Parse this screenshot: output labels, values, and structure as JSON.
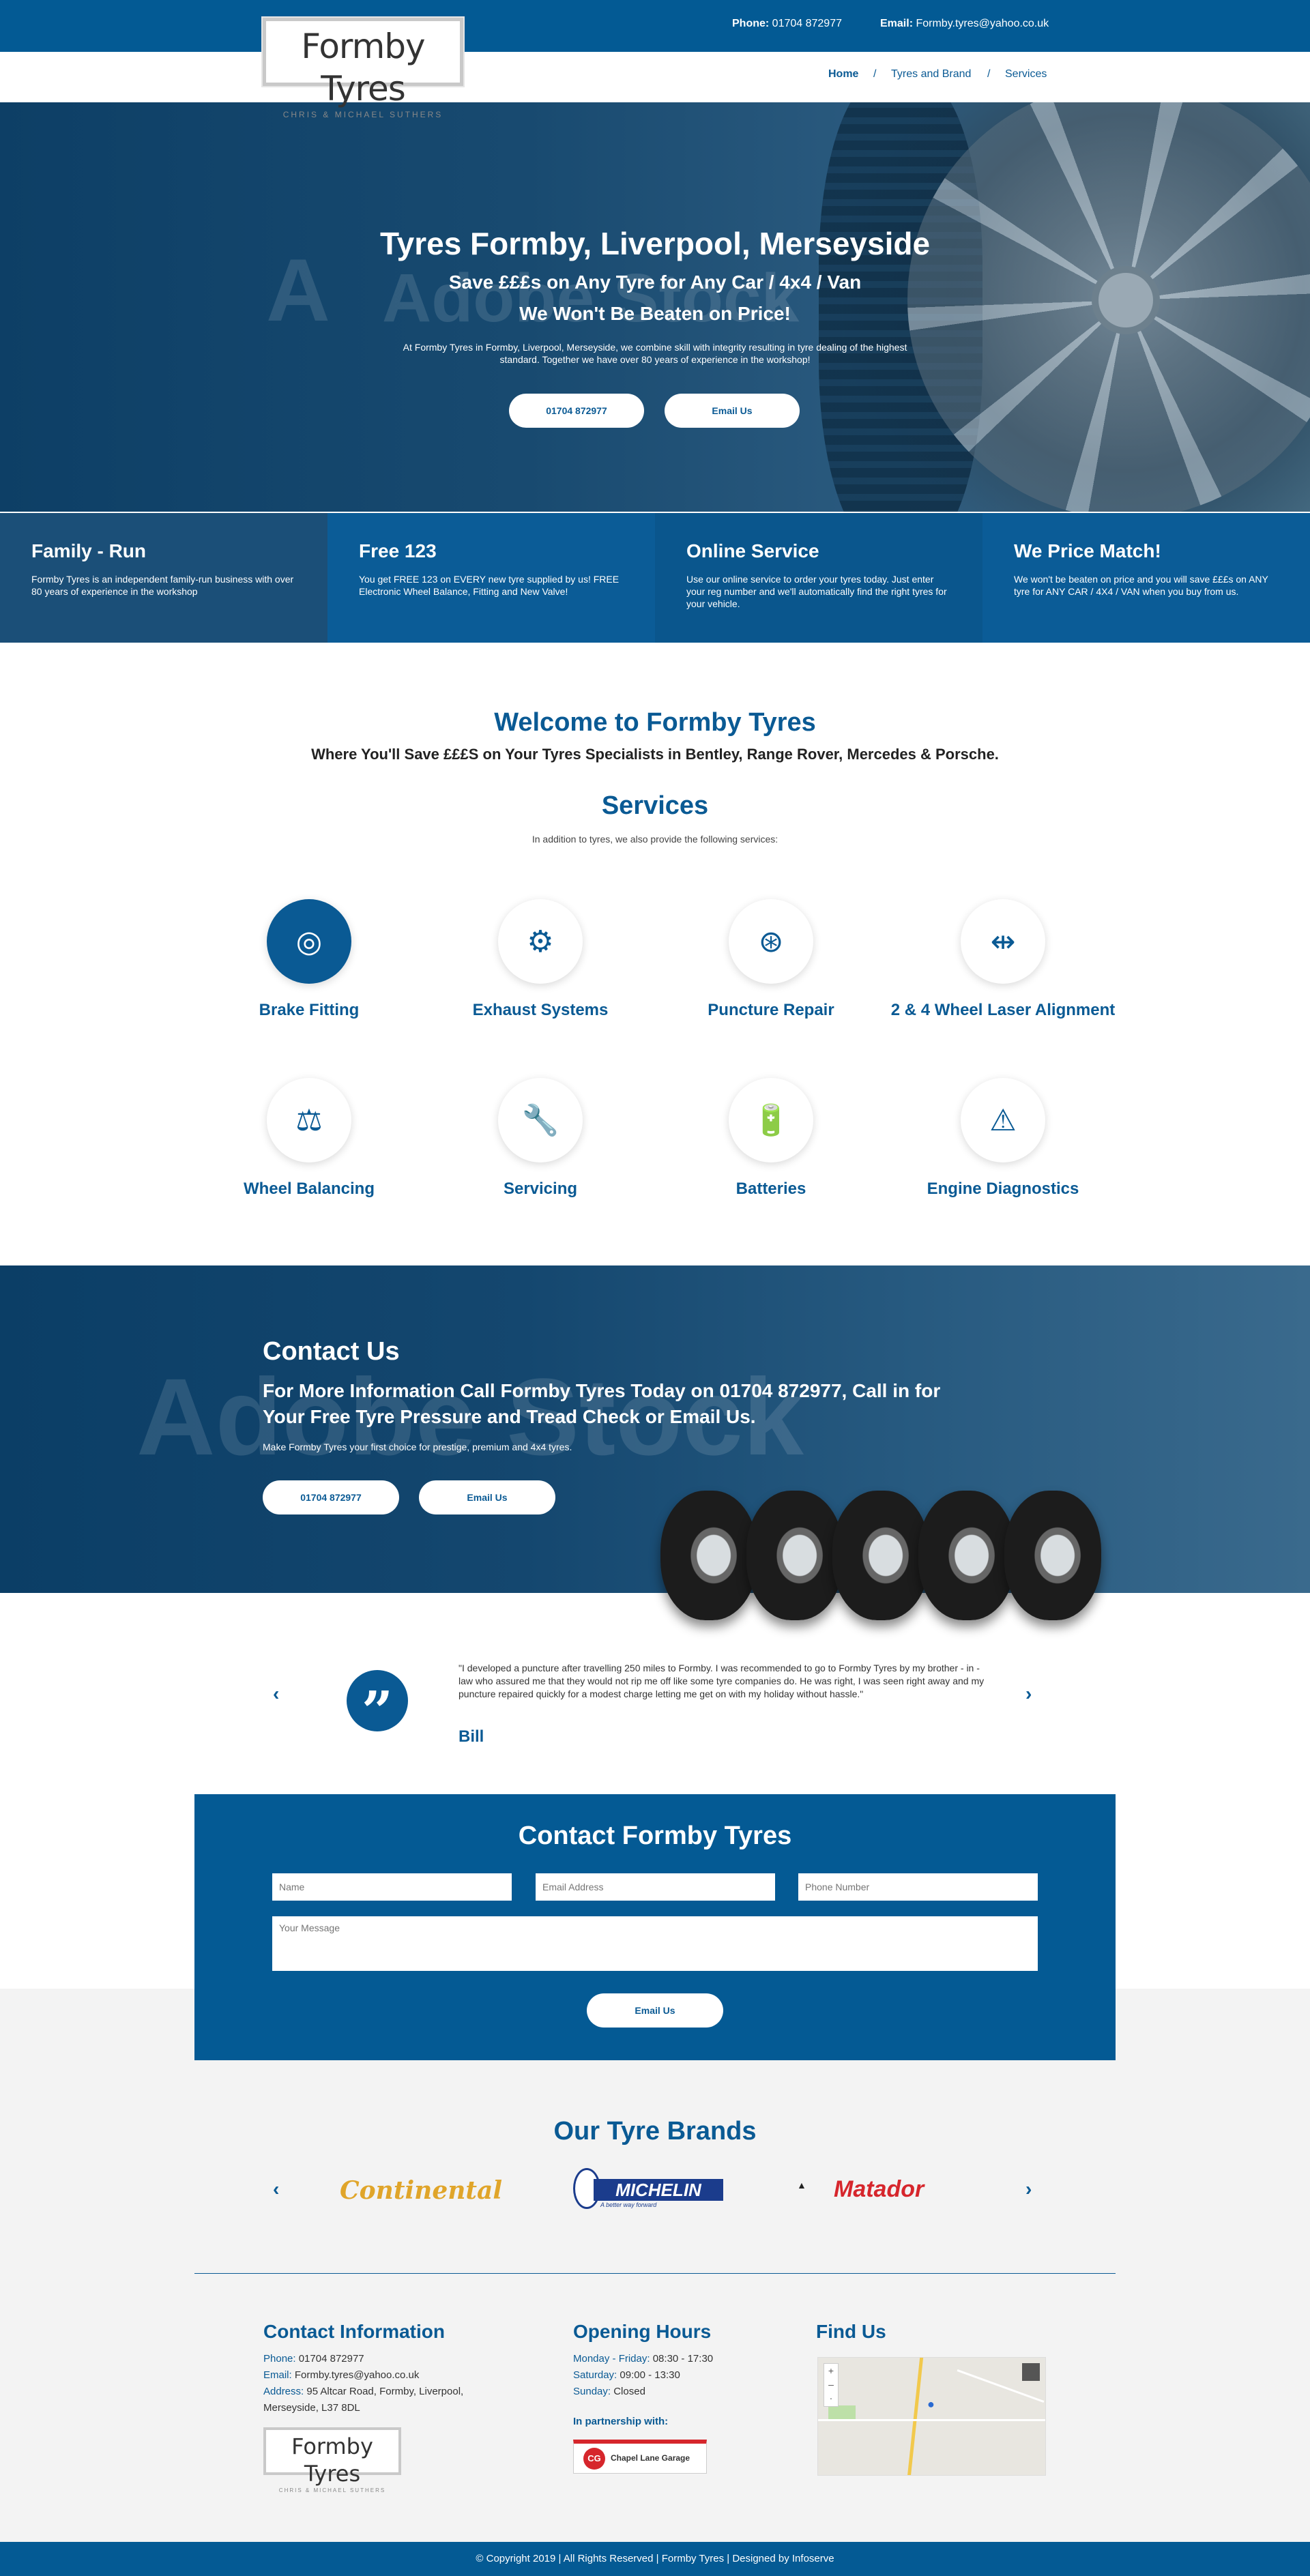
{
  "header": {
    "logo_main": "Formby Tyres",
    "logo_sub": "CHRIS & MICHAEL SUTHERS",
    "phone_label": "Phone:",
    "phone": "01704 872977",
    "email_label": "Email:",
    "email": "Formby.tyres@yahoo.co.uk"
  },
  "nav": {
    "items": [
      "Home",
      "Tyres and Brand",
      "Services"
    ],
    "separator": "/"
  },
  "hero": {
    "title": "Tyres Formby, Liverpool, Merseyside",
    "subtitle1": "Save £££s on Any Tyre for Any Car / 4x4 / Van",
    "subtitle2": "We Won't Be Beaten on Price!",
    "text": "At Formby Tyres in Formby, Liverpool, Merseyside, we combine skill with integrity resulting in tyre dealing of the highest standard. Together we have over 80 years of experience in the workshop!",
    "btn_phone": "01704 872977",
    "btn_email": "Email Us",
    "watermark": "Adobe Stock"
  },
  "features": [
    {
      "title": "Family - Run",
      "text": "Formby Tyres is an independent family-run business with over 80 years of experience in the workshop",
      "bg": "#1b4f78"
    },
    {
      "title": "Free 123",
      "text": "You get FREE 123 on EVERY new tyre supplied by us! FREE Electronic Wheel Balance, Fitting and New Valve!",
      "bg": "#0b5c97"
    },
    {
      "title": "Online Service",
      "text": "Use our online service to order your tyres today. Just enter your reg number and we'll automatically find the right tyres for your vehicle.",
      "bg": "#0a568d"
    },
    {
      "title": "We Price Match!",
      "text": "We won't be beaten on price and you will save £££s on ANY tyre for ANY CAR / 4X4 / VAN when you buy from us.",
      "bg": "#0b5c97"
    }
  ],
  "welcome": {
    "title": "Welcome to Formby Tyres",
    "subtitle": "Where You'll Save £££S on Your Tyres Specialists in Bentley, Range Rover, Mercedes & Porsche."
  },
  "services": {
    "title": "Services",
    "intro": "In addition to tyres, we also provide the following services:",
    "items": [
      {
        "label": "Brake Fitting",
        "icon": "brake-disc-icon",
        "glyph": "◎"
      },
      {
        "label": "Exhaust Systems",
        "icon": "exhaust-icon",
        "glyph": "⚙"
      },
      {
        "label": "Puncture Repair",
        "icon": "wheel-icon",
        "glyph": "⊛"
      },
      {
        "label": "2 & 4 Wheel Laser Alignment",
        "icon": "alignment-icon",
        "glyph": "⇹"
      },
      {
        "label": "Wheel Balancing",
        "icon": "balancing-icon",
        "glyph": "⚖"
      },
      {
        "label": "Servicing",
        "icon": "servicing-icon",
        "glyph": "🔧"
      },
      {
        "label": "Batteries",
        "icon": "battery-icon",
        "glyph": "🔋"
      },
      {
        "label": "Engine Diagnostics",
        "icon": "engine-icon",
        "glyph": "⚠"
      }
    ]
  },
  "contact_band": {
    "title": "Contact Us",
    "subtitle": "For More Information Call Formby Tyres Today on 01704 872977, Call in for Your Free Tyre Pressure and Tread Check or Email Us.",
    "text": "Make Formby Tyres your first choice for prestige, premium and 4x4 tyres.",
    "btn_phone": "01704 872977",
    "btn_email": "Email Us"
  },
  "testimonial": {
    "quote": "\"I developed a puncture after travelling 250 miles to Formby. I was recommended to go to Formby Tyres by my brother - in - law who assured me that they would not rip me off like some tyre companies do. He was right, I was seen right away and my puncture repaired quickly for a modest charge letting me get on with my holiday without hassle.\"",
    "author": "Bill",
    "prev": "‹",
    "next": "›"
  },
  "form": {
    "title": "Contact Formby Tyres",
    "name_placeholder": "Name",
    "email_placeholder": "Email Address",
    "phone_placeholder": "Phone Number",
    "message_placeholder": "Your Message",
    "submit": "Email Us"
  },
  "brands": {
    "title": "Our Tyre Brands",
    "items": [
      "Continental",
      "MICHELIN",
      "Matador"
    ],
    "michelin_tag": "A better way forward"
  },
  "footer_info": {
    "contact_title": "Contact Information",
    "phone_label": "Phone:",
    "phone": "01704 872977",
    "email_label": "Email:",
    "email": "Formby.tyres@yahoo.co.uk",
    "address_label": "Address:",
    "address1": "95 Altcar Road, Formby, Liverpool,",
    "address2": "Merseyside, L37 8DL",
    "hours_title": "Opening Hours",
    "hours": [
      {
        "day": "Monday - Friday:",
        "time": "08:30 - 17:30"
      },
      {
        "day": "Saturday:",
        "time": "09:00 - 13:30"
      },
      {
        "day": "Sunday:",
        "time": "Closed"
      }
    ],
    "partner_label": "In partnership with:",
    "partner_name": "Chapel Lane Garage",
    "partner_badge": "CG",
    "find_title": "Find Us"
  },
  "copyright": "© Copyright 2019 | All Rights Reserved | Formby Tyres | Designed by Infoserve",
  "colors": {
    "brand_blue": "#0a5a94",
    "grey_bg": "#f3f3f3"
  }
}
